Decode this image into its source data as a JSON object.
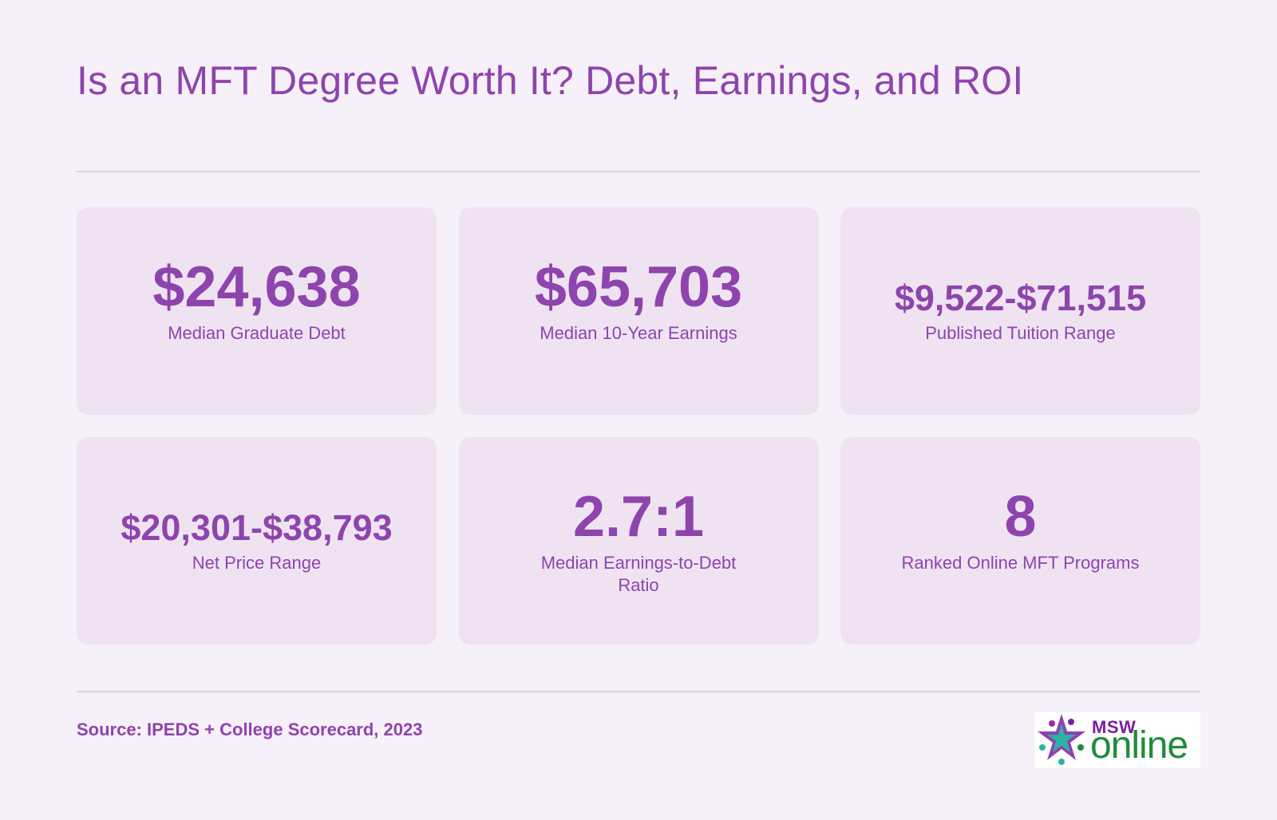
{
  "header": {
    "title": "Is an MFT Degree Worth It? Debt, Earnings, and ROI"
  },
  "stats": [
    {
      "value": "$24,638",
      "label": "Median Graduate Debt"
    },
    {
      "value": "$65,703",
      "label": "Median 10-Year Earnings"
    },
    {
      "value": "$9,522-$71,515",
      "label": "Published Tuition Range"
    },
    {
      "value": "$20,301-$38,793",
      "label": "Net Price Range"
    },
    {
      "value": "2.7:1",
      "label": "Median Earnings-to-Debt Ratio"
    },
    {
      "value": "8",
      "label": "Ranked Online MFT Programs"
    }
  ],
  "footer": {
    "source": "Source: IPEDS + College Scorecard, 2023",
    "logo_top": "MSW",
    "logo_main": "online"
  },
  "colors": {
    "background": "#f6f0f8",
    "card": "#efe3f2",
    "accent": "#8e44ad",
    "rule": "#e2cdea",
    "logo_purple": "#7b1fa2",
    "logo_green": "#1e8b3c",
    "logo_teal": "#2bb3a3"
  }
}
